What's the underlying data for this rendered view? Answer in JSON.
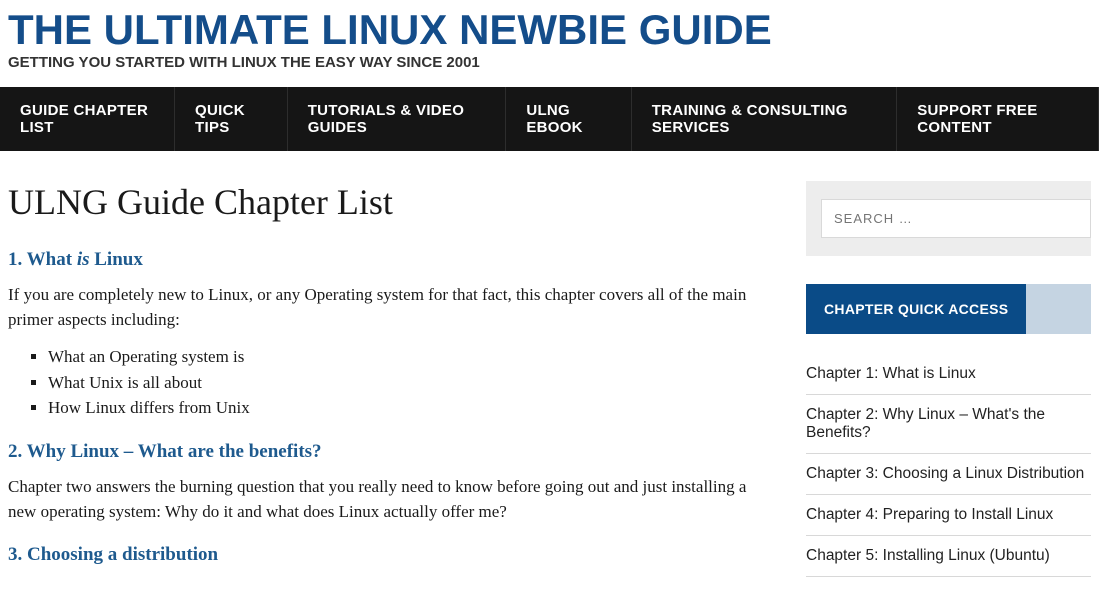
{
  "header": {
    "title": "THE ULTIMATE LINUX NEWBIE GUIDE",
    "tagline": "GETTING YOU STARTED WITH LINUX THE EASY WAY SINCE 2001"
  },
  "nav": [
    "GUIDE CHAPTER LIST",
    "QUICK TIPS",
    "TUTORIALS & VIDEO GUIDES",
    "ULNG EBOOK",
    "TRAINING & CONSULTING SERVICES",
    "SUPPORT FREE CONTENT"
  ],
  "main": {
    "page_title": "ULNG Guide Chapter List",
    "section1": {
      "head_prefix": "1. What ",
      "head_italic": "is",
      "head_suffix": " Linux",
      "para": "If you are completely new to Linux, or any Operating system for that fact, this chapter covers all of the main primer aspects including:",
      "bullets": [
        "What an Operating system is",
        "What Unix is all about",
        "How Linux differs from Unix"
      ]
    },
    "section2": {
      "head": "2. Why Linux – What are the benefits?",
      "para": "Chapter two answers the burning question that you really need to know before going out and just installing a new operating system: Why do it and what does Linux actually offer me?"
    },
    "section3": {
      "head": "3. Choosing a distribution"
    }
  },
  "sidebar": {
    "search_placeholder": "SEARCH …",
    "widget_title": "CHAPTER QUICK ACCESS",
    "chapters": [
      "Chapter 1: What is Linux",
      "Chapter 2: Why Linux – What's the Benefits?",
      "Chapter 3: Choosing a Linux Distribution",
      "Chapter 4: Preparing to Install Linux",
      "Chapter 5: Installing Linux (Ubuntu)"
    ]
  }
}
